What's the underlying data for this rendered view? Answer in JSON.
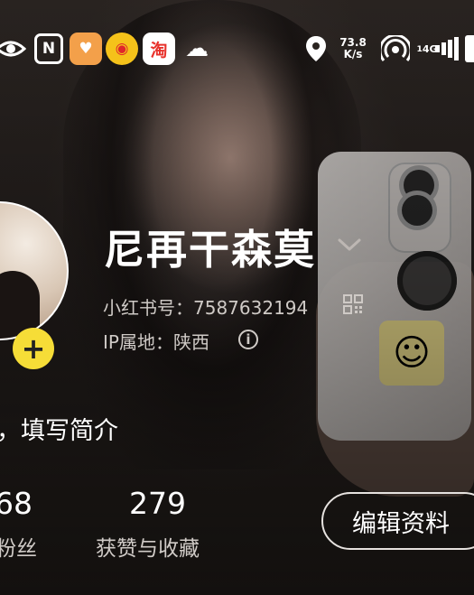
{
  "status_bar": {
    "net_speed_value": "73.8",
    "net_speed_unit": "K/s",
    "network_type": "4G",
    "sim_label": "1",
    "app_icons": [
      "eye-icon",
      "nfc-icon",
      "heart-app-icon",
      "weibo-icon",
      "taobao-icon",
      "wechat-icon"
    ],
    "nfc_text": "N",
    "taobao_text": "淘"
  },
  "profile": {
    "nickname": "尼再干森莫",
    "id_label": "小红书号：",
    "id_value": "7587632194",
    "ip_label": "IP属地：",
    "ip_value": "陕西",
    "bio_placeholder": "，填写简介"
  },
  "stats": {
    "fans_count": "68",
    "fans_label": "粉丝",
    "likes_count": "279",
    "likes_label": "获赞与收藏"
  },
  "actions": {
    "edit_profile_label": "编辑资料",
    "add_symbol": "+"
  },
  "colors": {
    "add_button": "#f6dd37",
    "text_primary": "#ffffff",
    "text_secondary": "#cfcac6"
  }
}
